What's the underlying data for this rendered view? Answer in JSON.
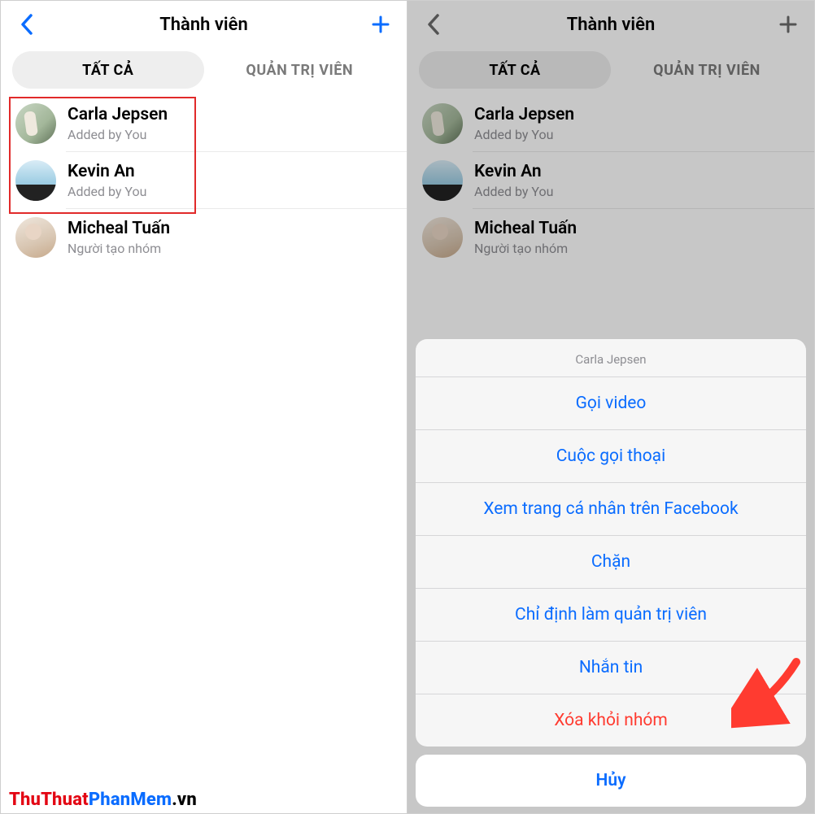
{
  "left": {
    "header": {
      "title": "Thành viên"
    },
    "tabs": {
      "all": "TẤT CẢ",
      "admins": "QUẢN TRỊ VIÊN"
    },
    "members": [
      {
        "name": "Carla Jepsen",
        "sub": "Added by You"
      },
      {
        "name": "Kevin An",
        "sub": "Added by You"
      },
      {
        "name": "Micheal Tuấn",
        "sub": "Người tạo nhóm"
      }
    ]
  },
  "right": {
    "header": {
      "title": "Thành viên"
    },
    "tabs": {
      "all": "TẤT CẢ",
      "admins": "QUẢN TRỊ VIÊN"
    },
    "members": [
      {
        "name": "Carla Jepsen",
        "sub": "Added by You"
      },
      {
        "name": "Kevin An",
        "sub": "Added by You"
      },
      {
        "name": "Micheal Tuấn",
        "sub": "Người tạo nhóm"
      }
    ],
    "sheet": {
      "title": "Carla Jepsen",
      "items": [
        "Gọi video",
        "Cuộc gọi thoại",
        "Xem trang cá nhân trên Facebook",
        "Chặn",
        "Chỉ định làm quản trị viên",
        "Nhắn tin",
        "Xóa khỏi nhóm"
      ],
      "cancel": "Hủy"
    }
  },
  "watermark": {
    "a": "ThuThuat",
    "b": "PhanMem",
    "c": ".vn"
  },
  "colors": {
    "accent": "#0a6cff",
    "danger": "#ff3b30",
    "hl": "#e12a2a"
  }
}
